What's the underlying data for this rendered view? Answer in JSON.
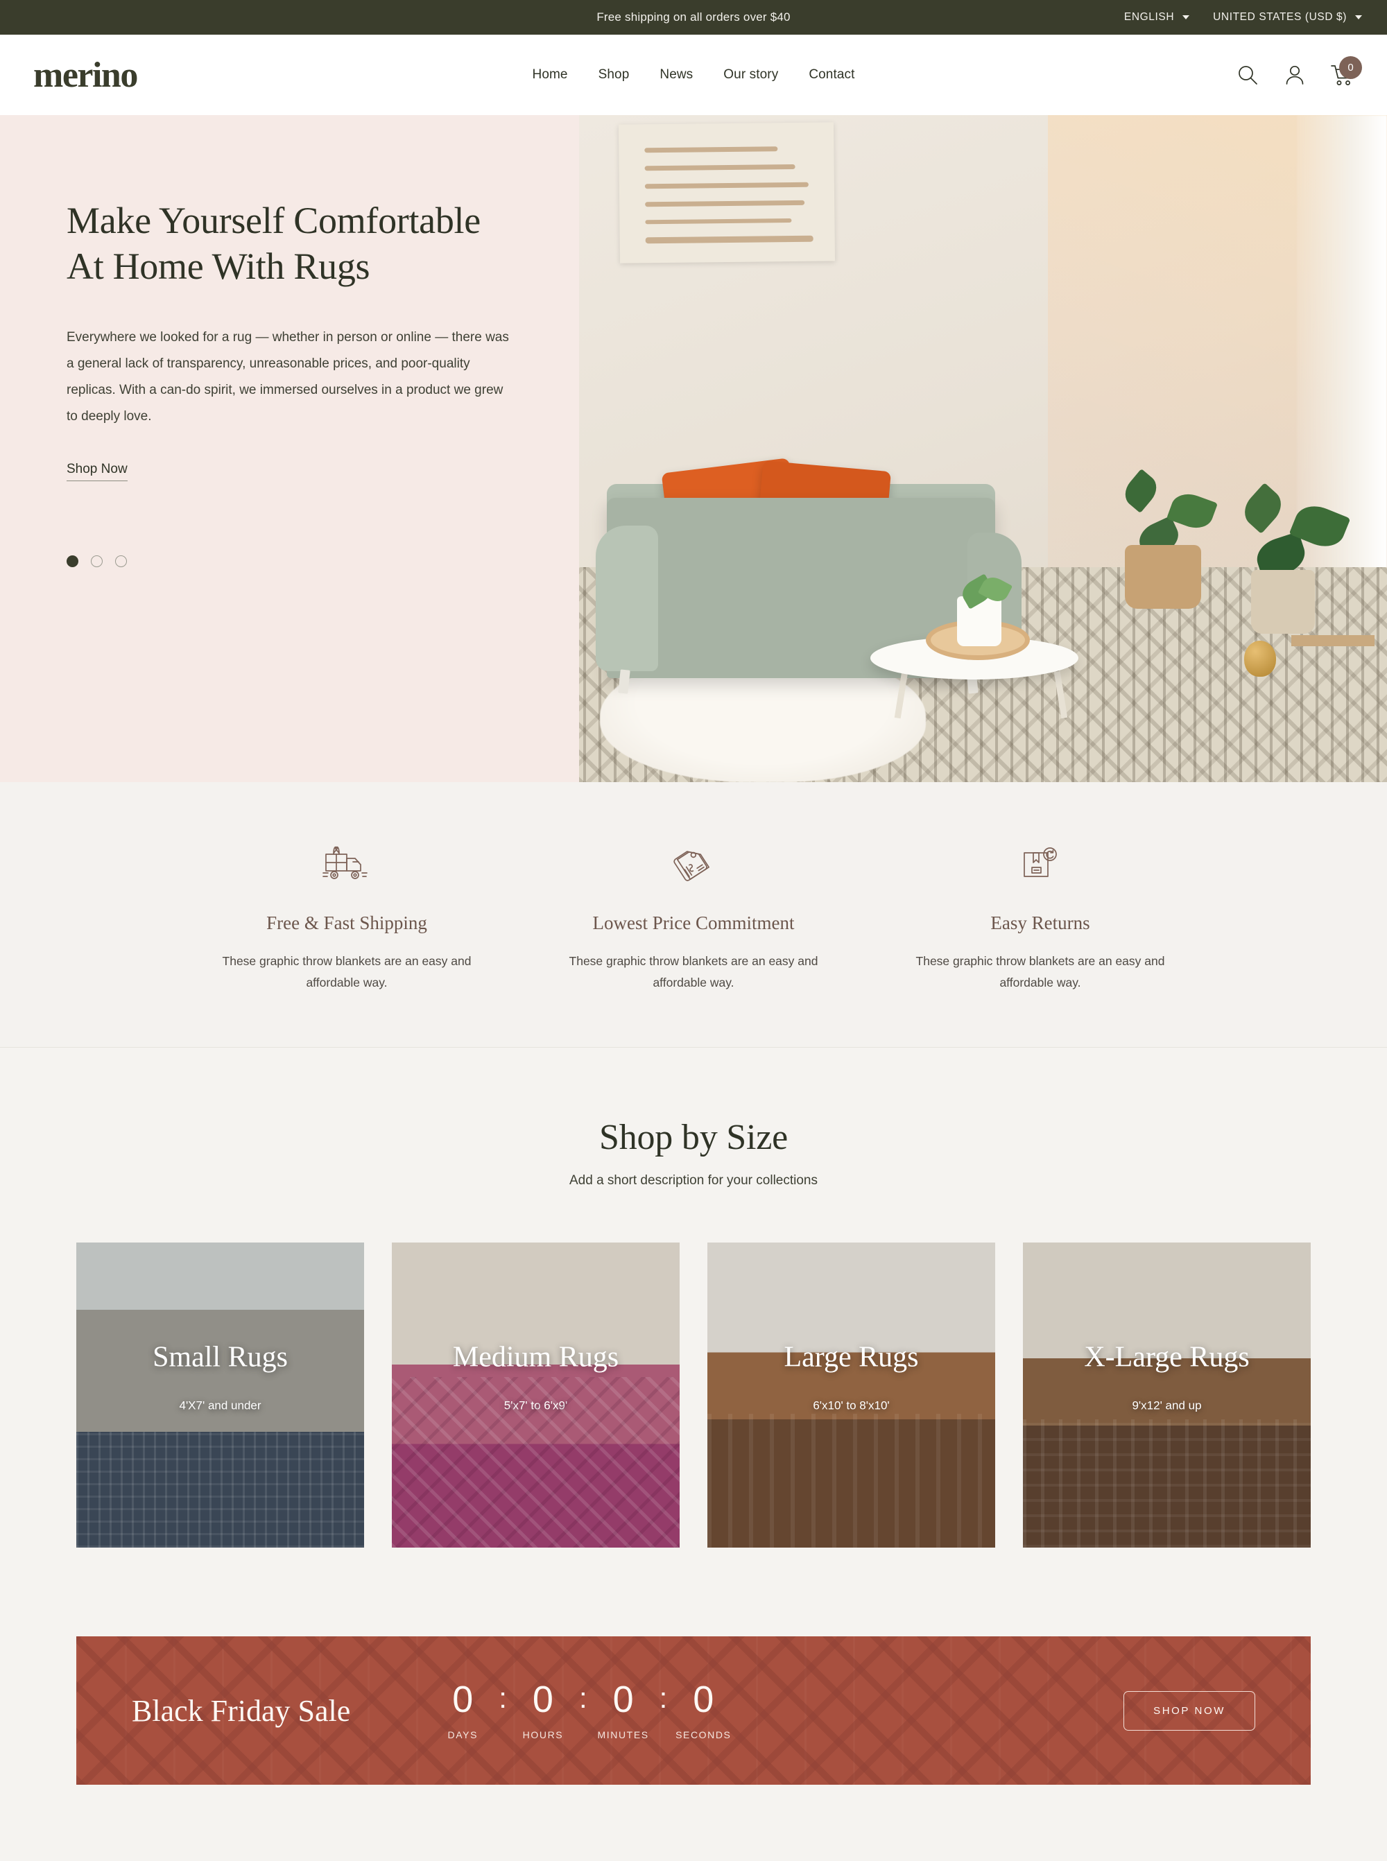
{
  "announcement": {
    "text": "Free shipping on all orders over $40",
    "language": "ENGLISH",
    "country": "UNITED STATES (USD $)"
  },
  "header": {
    "logo": "merino",
    "nav": [
      {
        "label": "Home"
      },
      {
        "label": "Shop"
      },
      {
        "label": "News"
      },
      {
        "label": "Our story"
      },
      {
        "label": "Contact"
      }
    ],
    "cart_count": "0"
  },
  "hero": {
    "title": "Make Yourself Comfortable At Home With Rugs",
    "body": "Everywhere we looked for a rug — whether in person or online — there was a general lack of transparency, unreasonable prices, and poor-quality replicas. With a can-do spirit, we immersed ourselves in a product we grew to deeply love.",
    "cta": "Shop Now",
    "slide_count": 3,
    "active_slide": 1
  },
  "features": [
    {
      "icon": "delivery-truck-icon",
      "title": "Free & Fast Shipping",
      "desc": "These graphic throw blankets are an easy and affordable way."
    },
    {
      "icon": "price-tag-icon",
      "title": "Lowest Price Commitment",
      "desc": "These graphic throw blankets are an easy and affordable way."
    },
    {
      "icon": "return-box-icon",
      "title": "Easy Returns",
      "desc": "These graphic throw blankets are an easy and affordable way."
    }
  ],
  "collections": {
    "title": "Shop by Size",
    "subtitle": "Add a short description for your collections",
    "items": [
      {
        "name": "Small Rugs",
        "size": "4'X7' and under"
      },
      {
        "name": "Medium Rugs",
        "size": "5'x7' to 6'x9'"
      },
      {
        "name": "Large Rugs",
        "size": "6'x10' to 8'x10'"
      },
      {
        "name": "X-Large Rugs",
        "size": "9'x12' and up"
      }
    ]
  },
  "promo": {
    "title": "Black Friday Sale",
    "countdown": [
      {
        "value": "0",
        "label": "DAYS"
      },
      {
        "value": "0",
        "label": "HOURS"
      },
      {
        "value": "0",
        "label": "MINUTES"
      },
      {
        "value": "0",
        "label": "SECONDS"
      }
    ],
    "separator": ":",
    "button": "SHOP NOW"
  },
  "colors": {
    "dark_green": "#3a3d2c",
    "hero_bg": "#f6eae6",
    "page_bg": "#f5f3f0",
    "feature_bg": "#f4f2ef",
    "brown_accent": "#7d6257",
    "feature_title": "#6c564c",
    "promo_bg": "#a8503f"
  }
}
